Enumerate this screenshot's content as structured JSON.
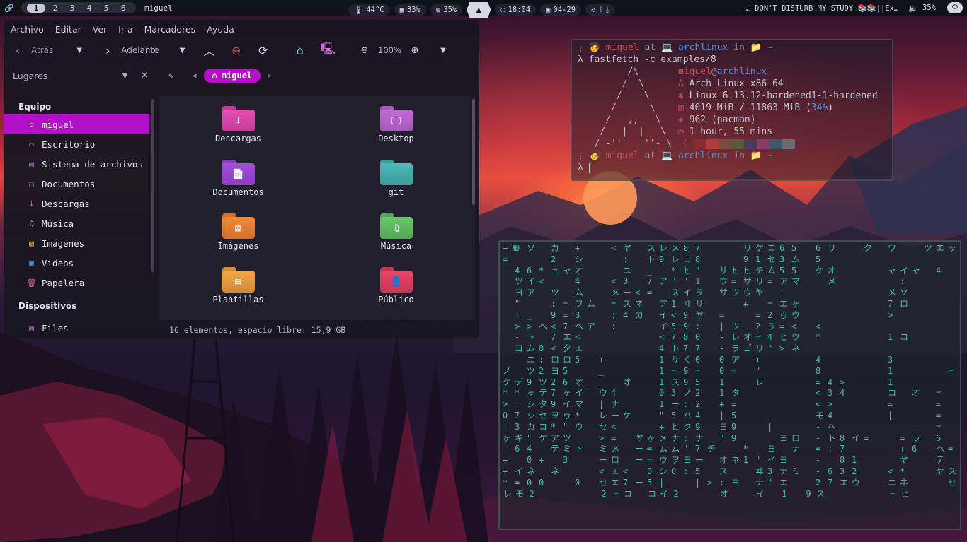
{
  "topbar": {
    "workspaces": [
      "1",
      "2",
      "3",
      "4",
      "5",
      "6"
    ],
    "active_workspace": "1",
    "window_title": "miguel",
    "temperature": "44°C",
    "cpu": "33%",
    "memory": "35%",
    "time": "18:04",
    "date": "04-29",
    "media": "DON'T DISTURB MY STUDY 📚📚||Ex…",
    "volume": "35%"
  },
  "file_manager": {
    "menu": [
      "Archivo",
      "Editar",
      "Ver",
      "Ir a",
      "Marcadores",
      "Ayuda"
    ],
    "back_label": "Atrás",
    "forward_label": "Adelante",
    "zoom": "100%",
    "places_label": "Lugares",
    "breadcrumb_current": "miguel",
    "sidebar": {
      "sections": [
        {
          "title": "Equipo",
          "items": [
            {
              "label": "miguel",
              "icon": "home-icon",
              "active": true
            },
            {
              "label": "Escritorio",
              "icon": "desktop-icon"
            },
            {
              "label": "Sistema de archivos",
              "icon": "drive-icon"
            },
            {
              "label": "Documentos",
              "icon": "document-icon"
            },
            {
              "label": "Descargas",
              "icon": "download-icon"
            },
            {
              "label": "Música",
              "icon": "music-icon"
            },
            {
              "label": "Imágenes",
              "icon": "image-icon"
            },
            {
              "label": "Videos",
              "icon": "video-icon"
            },
            {
              "label": "Papelera",
              "icon": "trash-icon"
            }
          ]
        },
        {
          "title": "Dispositivos",
          "items": [
            {
              "label": "Files",
              "icon": "drive-icon"
            }
          ]
        }
      ]
    },
    "folders": [
      {
        "label": "Descargas",
        "color": "#e64fb4",
        "tab": "#c23c96",
        "glyph": "⤓"
      },
      {
        "label": "Desktop",
        "color": "#c36ad6",
        "tab": "#a45ab8",
        "glyph": "🖵"
      },
      {
        "label": "Documentos",
        "color": "#a44fdc",
        "tab": "#8a3cc0",
        "glyph": "📄"
      },
      {
        "label": "git",
        "color": "#4fb8b8",
        "tab": "#3c9c9c",
        "glyph": ""
      },
      {
        "label": "Imágenes",
        "color": "#f08a3a",
        "tab": "#d4702a",
        "glyph": "▨"
      },
      {
        "label": "Música",
        "color": "#6ac86a",
        "tab": "#52a852",
        "glyph": "♫"
      },
      {
        "label": "Plantillas",
        "color": "#f2a84a",
        "tab": "#d48c34",
        "glyph": "▤"
      },
      {
        "label": "Público",
        "color": "#e84a6a",
        "tab": "#c83454",
        "glyph": "👤"
      }
    ],
    "status": "16 elementos, espacio libre: 15,9 GB"
  },
  "fastfetch": {
    "prompt_user": "miguel",
    "prompt_at": "at",
    "prompt_host": "archlinux",
    "prompt_in": "in",
    "prompt_dir": "~",
    "command": "λ fastfetch -c examples/8",
    "title_user": "miguel",
    "title_host": "archlinux",
    "os": "Arch Linux x86_64",
    "kernel": "Linux 6.13.12-hardened1-1-hardened",
    "memory": "4019 MiB / 11863 MiB",
    "memory_pct": "34%",
    "packages": "962 (pacman)",
    "uptime": "1 hour, 55 mins",
    "swatches": [
      "#8a2a34",
      "#b03a3a",
      "#7a4a3a",
      "#5a5a3a",
      "#4a3a5a",
      "#8a3a6a",
      "#3a5a6a",
      "#6a6a72"
    ],
    "second_prompt": "λ"
  },
  "matrix": {
    "columns": [
      "+ 6\n= \n  \n  \n  \n  \n  \n  \n  \n  \n  \nノ \nケ \n* \n> \n0 \n| \nヶ \n- \n+ \n+ \n* \nレ",
      "0 \n  \n4 \nツ \nヨ \n\" \n| \n> \n- \nヨ \n- \n  \nデ \n* \n: \n7 \n3 \nキ \n6 \n  \nイ \n= \nモ",
      "ソ \n  \n6 \nイ \nア \n  \n_ \n> \nト \nム \nニ \nツ \n9 \nヶ \nシ \nシ \nカ \n\" \n4 \n0 \nネ \n0 \n2",
      "  \n  \n* \n< \n  \n  \n  \nヘ \n  \n8 \n: \n2 \nツ \nテ \nタ \nセ \nコ \nケ \n  \n+ \n  \n0 \n ",
      "カ \n2 \nュ \n  \nツ \n: \n9 \n< \n7 \n< \nロ \nヨ \n2 \n7 \n9 \nヲ \n* \nア \nテ \n  \nネ \n  \n ",
      "  \n  \nャ \n  \n  \n= \n= \n7 \nエ \n夕 \nロ \n5 \n6 \nヶ \nイ \nヮ \n\" \nツ \nミ \n3 \n  \n  \n ",
      "+ \nシ \nオ \n4 \nム \nフ \n8 \nへ \n< \nエ \n5 \n  \nオ \nイ \nマ \n* \nウ \n  \nト \n  \n  \n0 \n ",
      "  \n  \n  \n  \n  \nム \n  \nア \n  \n  \n  \n  \n_ \n  \n  \n  \n  \n  \n  \n  \n  \n  \n ",
      "  \n  \n  \n  \n  \n  \n  \n  \n  \n  \n+ \n_ \n_ \nウ \n| \nレ \nセ \n> \nミ \nー \n< \nセ \n2",
      "< \n  \n  \n< \nメ \n= \n: \n: \n  \n  \n  \n  \n  \n4 \nナ \nー \n< \n= \nメ \nロ \nエ \nエ \n=",
      "ヤ \n: \nユ \n0 \nー \nス \n4 \n  \n  \n  \n  \n  \nオ \n  \n  \nケ \n  \n  \n  \n  \n< \n7 \nコ",
      "  \n  \n  \n  \n< \nネ \nカ \n  \n  \n  \n  \n  \n  \n  \n  \n  \n  \nヤ \nー \nー \n  \nー \n ",
      "ス \nト \n_ \n7 \n= \n  \n  \n  \n  \n  \n  \n  \n  \n  \n  \n  \n  \nヶ \n= \n= \n0 \n5 \nコ",
      "レ \n9 \n  \nア \n  \nア \nイ \nイ \n< \n4 \n1 \n1 \n1 \n0 \n1 \n\" \n+ \nメ \nム \nウ \nシ \n| \nイ",
      "メ \nレ \n* \n\" \nス \n1 \n< \n5 \n7 \nト \nサ \n= \nス \n3 \nー \n5 \nヒ \nナ \nム \nヲ \n0 \n  \n2",
      "8 \nコ \nヒ \n\" \nイ \nヰ \n9 \n9 \n8 \n7 \nく \n9 \n9 \nノ \n: \nハ \nク \n: \n\" \nヨ \n: \n  \n ",
      "7 \n8 \n\" \n1 \nヲ \nサ \nヤ \n: \n0 \n7 \n0 \n= \n5 \n2 \n2 \n4 \n9 \nナ \n7 \nー \n5 \n| \n ",
      "  \n  \n  \n  \n  \n  \n  \n  \n  \n  \n  \n  \n  \n  \n  \n  \n  \n  \nチ \n  \n  \n> \n ",
      "  \n  \nサ \nウ \nサ \n  \n= \n| \n- \n- \n0 \n0 \n1 \n1 \n+ \n| \nヨ \n\" \n  \nオ \nス \n: \nオ",
      "  \n  \nヒ \n= \nツ \n  \n  \nツ \nレ \nラ \nア \n= \n  \nタ \n= \n5 \n9 \n9 \n  \nネ \n  \nヨ \n ",
      "リ \n9 \nヒ \nサ \nウ \n+ \n  \n_ \nオ \nゴ \n  \n  \n  \n  \n  \n  \n  \n  \n* \n1 \n  \n  \n ",
      "ケ \n1 \nチ \nリ \nヤ \n  \n= \n2 \n= \nリ \n+ \n\" \nレ \n  \n  \n  \n  \n  \n  \n\" \nヰ \nナ \nイ",
      "コ \nセ \nム \n= \n  \n= \n2 \nヲ \n4 \n\" \n  \n  \n  \n  \n  \n  \n| \n  \nヨ \nイ \n3 \n\" \n ",
      "6 \n3 \n5 \nア \n- \nエ \nゥ \n= \nヒ \n> \n  \n  \n  \n  \n  \n  \n  \nヨ \n  \nヨ \nナ \nエ \n1",
      "5 \nム \n5 \nマ \n  \nヶ \nウ \n< \nウ \nネ \n  \n  \n  \n  \n  \n  \n  \nロ \nナ \n  \nミ \n  \n ",
      "  \n  \n  \n  \n  \n  \n  \n  \n  \n  \n  \n  \n  \n  \n  \n  \n  \n  \n  \n  \n  \n  \n9",
      "6 \n5 \nケ \n  \n  \n  \n  \n< \n* \n  \n4 \n8 \n= \n< \n< \nモ \n- \n- \n= \n- \n- \n2 \nス",
      "リ \n  \nオ \nメ \n  \n  \n  \n  \n  \n  \n  \n  \n4 \n3 \n> \n4 \nヘ \nト \n: \n  \n6 \n7 \n ",
      "  \n  \n  \n  \n  \n  \n  \n  \n  \n  \n  \n  \n> \n4 \n  \n  \n  \n8 \n7 \n8 \n3 \nエ \n ",
      "  \n  \n  \n  \n  \n  \n  \n  \n  \n  \n  \n  \n  \n  \n  \n  \n  \nイ \n  \n1 \n2 \nウ \n ",
      "ク \n  \n  \n  \n  \n  \n  \n  \n  \n  \n  \n  \n  \n  \n  \n  \n  \n= \n  \n  \n  \n  \n ",
      "  \n  \n  \n  \n  \n  \n  \n  \n  \n  \n  \n  \n  \n  \n  \n  \n  \n  \n  \n  \n  \n  \n ",
      "ワ \n  \nャ \n  \nメ \n7 \n> \n  \n1 \n  \n3 \n1 \n1 \nコ \n= \n| \n  \n  \n  \n  \n< \nニ \n=",
      "  \n  \nイ \n: \nソ \nロ \n  \n  \nコ \n  \n  \n  \n  \n  \n  \n  \n  \n= \n+ \nヤ \n* \nネ \nヒ",
      "  \n  \nャ \n  \n  \n  \n  \n  \n  \n  \n  \n  \n  \nオ \n  \n  \n  \nラ \n6 \n  \n  \n  \n ",
      "ツ \n  \n  \n  \n  \n  \n  \n  \n  \n  \n  \n  \n  \n  \n  \n  \n  \n  \n  \n  \n  \n  \n ",
      "エ \n  \n4 \n  \n  \n  \n  \n  \n  \n  \n  \n  \n  \n= \n= \n= \n= \n6 \nヘ \nテ \nヤ \n  \n ",
      "ッ \n  \n  \n  \n  \n  \n  \n  \n  \n  \n  \n= \n  \n  \n  \n  \n  \n  \n= \n  \nス \nセ \n "
    ]
  }
}
